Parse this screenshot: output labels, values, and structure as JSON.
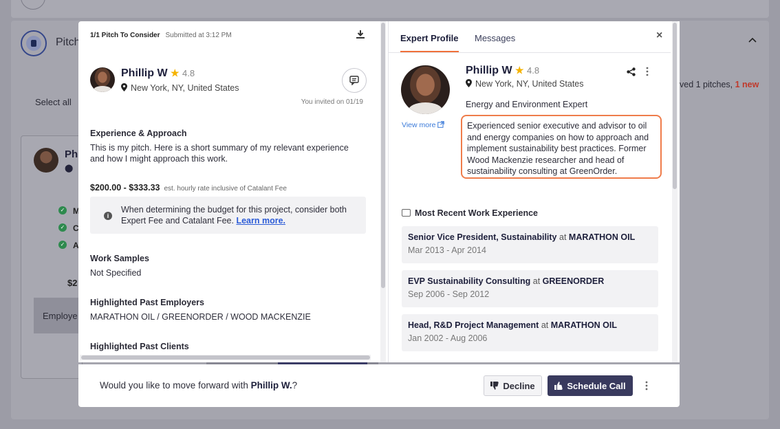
{
  "background": {
    "section_title": "Pitch",
    "select_all": "Select all",
    "received_text": "ved 1 pitches, ",
    "received_new": "1 new",
    "card_name": "Ph",
    "card_price": "$2",
    "card_employer": "Employe",
    "check_letters": [
      "M",
      "C",
      "A"
    ]
  },
  "pitch": {
    "header_title": "1/1 Pitch To Consider",
    "submitted": "Submitted at 3:12 PM",
    "expert_name": "Phillip W",
    "rating": "4.8",
    "location": "New York, NY, United States",
    "invited": "You invited on 01/19",
    "experience_title": "Experience & Approach",
    "experience_body": "This is my pitch. Here is a short summary of my relevant experience and how I might approach this work.",
    "price": "$200.00 - $333.33",
    "price_note": "est. hourly rate inclusive of Catalant Fee",
    "info_text": "When determining the budget for this project, consider both Expert Fee and Catalant Fee.",
    "info_link": "Learn more.",
    "work_samples_title": "Work Samples",
    "work_samples_body": "Not Specified",
    "past_employers_title": "Highlighted Past Employers",
    "past_employers_body": "MARATHON OIL / GREENORDER / WOOD MACKENZIE",
    "past_clients_title": "Highlighted Past Clients"
  },
  "profile": {
    "tabs": [
      "Expert Profile",
      "Messages"
    ],
    "close": "×",
    "expert_name": "Phillip W",
    "rating": "4.8",
    "location": "New York, NY, United States",
    "view_more": "View more",
    "headline": "Energy and Environment Expert",
    "summary": "Experienced senior executive and advisor to oil and energy companies on how to approach and implement sustainability best practices. Former Wood Mackenzie researcher and head of sustainability consulting at GreenOrder.",
    "work_title": "Most Recent Work Experience",
    "jobs": [
      {
        "title": "Senior Vice President, Sustainability",
        "at": "at",
        "company": "MARATHON OIL",
        "dates": "Mar 2013 - Apr 2014"
      },
      {
        "title": "EVP Sustainability Consulting",
        "at": "at",
        "company": "GREENORDER",
        "dates": "Sep 2006 - Sep 2012"
      },
      {
        "title": "Head, R&D Project Management",
        "at": "at",
        "company": "MARATHON OIL",
        "dates": "Jan 2002 - Aug 2006"
      }
    ]
  },
  "action_bar": {
    "question_prefix": "Would you like to move forward with ",
    "question_name": "Phillip W.",
    "question_suffix": "?",
    "decline_label": "Decline",
    "schedule_label": "Schedule Call"
  },
  "colors": {
    "accent_orange": "#ef7c4a",
    "primary_button": "#393a5e",
    "link_blue": "#2b5bd7",
    "star": "#f5b301"
  },
  "icons": [
    "download-icon",
    "location-pin-icon",
    "message-icon",
    "star-icon",
    "info-icon",
    "external-link-icon",
    "share-icon",
    "more-vertical-icon",
    "close-icon",
    "briefcase-icon",
    "thumbs-down-icon",
    "thumbs-up-icon",
    "chevron-up-icon"
  ]
}
